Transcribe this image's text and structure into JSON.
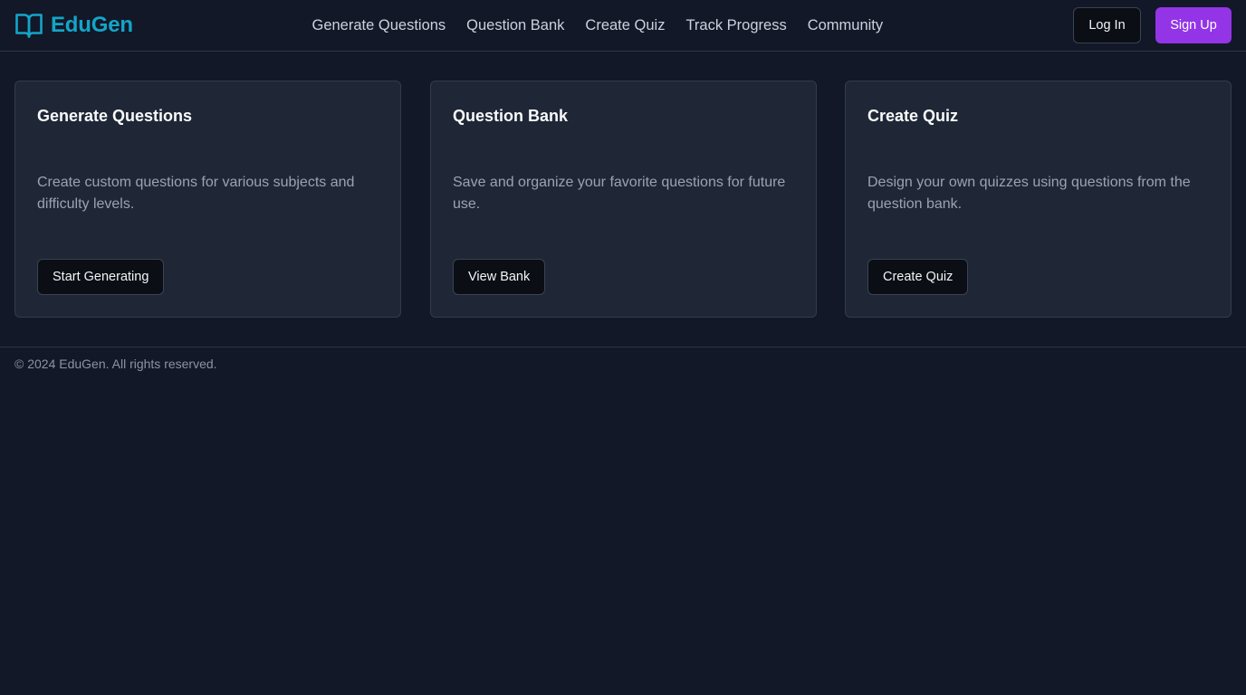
{
  "brand": {
    "name": "EduGen",
    "icon": "open-book-icon",
    "color": "#14a5c8"
  },
  "nav": {
    "links": [
      {
        "label": "Generate Questions"
      },
      {
        "label": "Question Bank"
      },
      {
        "label": "Create Quiz"
      },
      {
        "label": "Track Progress"
      },
      {
        "label": "Community"
      }
    ]
  },
  "auth": {
    "login_label": "Log In",
    "signup_label": "Sign Up",
    "signup_color": "#9334e6"
  },
  "cards": [
    {
      "title": "Generate Questions",
      "description": "Create custom questions for various subjects and difficulty levels.",
      "button_label": "Start Generating"
    },
    {
      "title": "Question Bank",
      "description": "Save and organize your favorite questions for future use.",
      "button_label": "View Bank"
    },
    {
      "title": "Create Quiz",
      "description": "Design your own quizzes using questions from the question bank.",
      "button_label": "Create Quiz"
    }
  ],
  "footer": {
    "text": "© 2024 EduGen. All rights reserved."
  },
  "colors": {
    "background": "#121827",
    "card": "#1f2737",
    "accent": "#14a5c8",
    "primary_button": "#9334e6"
  }
}
